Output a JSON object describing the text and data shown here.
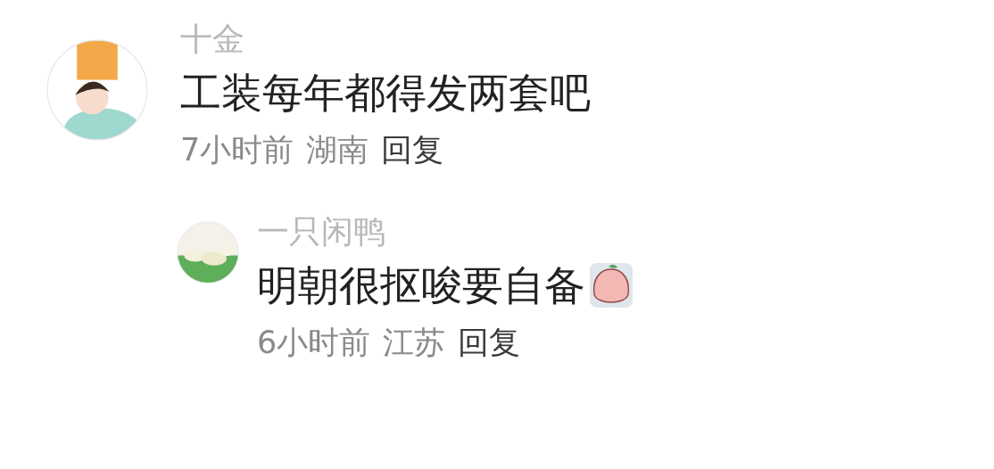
{
  "comments": [
    {
      "username": "十金",
      "text": "工装每年都得发两套吧",
      "time": "7小时前",
      "location": "湖南",
      "reply": "回复",
      "has_sticker": false,
      "children": [
        {
          "username": "一只闲鸭",
          "text": "明朝很抠唆要自备",
          "time": "6小时前",
          "location": "江苏",
          "reply": "回复",
          "has_sticker": true
        }
      ]
    }
  ]
}
